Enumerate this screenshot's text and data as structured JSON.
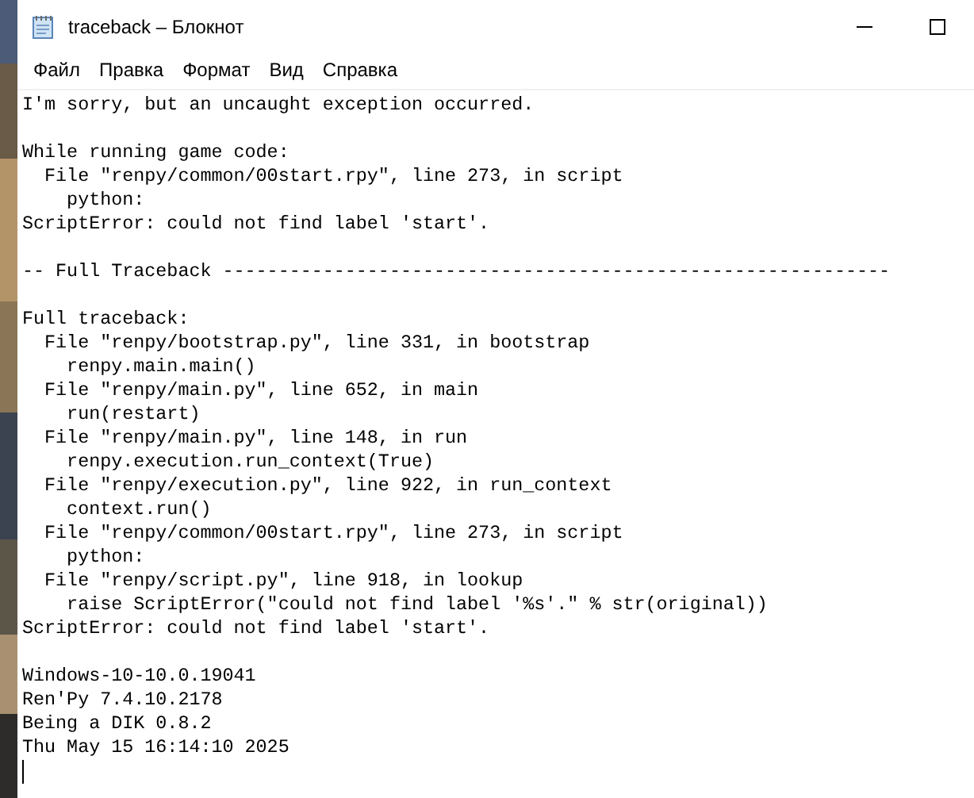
{
  "window": {
    "title": "traceback – Блокнот"
  },
  "menu": [
    "Файл",
    "Правка",
    "Формат",
    "Вид",
    "Справка"
  ],
  "document": {
    "blocks": [
      [
        "I'm sorry, but an uncaught exception occurred."
      ],
      [
        "While running game code:",
        "  File \"renpy/common/00start.rpy\", line 273, in script",
        "    python:",
        "ScriptError: could not find label 'start'."
      ],
      [
        "-- Full Traceback ------------------------------------------------------------"
      ],
      [
        "Full traceback:",
        "  File \"renpy/bootstrap.py\", line 331, in bootstrap",
        "    renpy.main.main()",
        "  File \"renpy/main.py\", line 652, in main",
        "    run(restart)",
        "  File \"renpy/main.py\", line 148, in run",
        "    renpy.execution.run_context(True)",
        "  File \"renpy/execution.py\", line 922, in run_context",
        "    context.run()",
        "  File \"renpy/common/00start.rpy\", line 273, in script",
        "    python:",
        "  File \"renpy/script.py\", line 918, in lookup",
        "    raise ScriptError(\"could not find label '%s'.\" % str(original))",
        "ScriptError: could not find label 'start'."
      ],
      [
        "Windows-10-10.0.19041",
        "Ren'Py 7.4.10.2178",
        "Being a DIK 0.8.2",
        "Thu May 15 16:14:10 2025"
      ]
    ]
  }
}
